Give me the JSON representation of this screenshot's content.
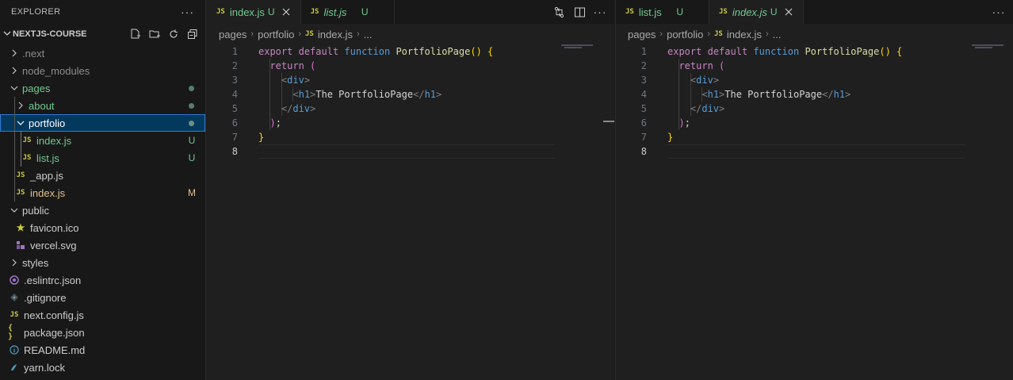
{
  "sidebar": {
    "header": "EXPLORER",
    "more": "···",
    "project": "NEXTJS-COURSE",
    "items": [
      {
        "label": ".next",
        "type": "folder",
        "open": false,
        "depth": 0
      },
      {
        "label": "node_modules",
        "type": "folder",
        "open": false,
        "depth": 0
      },
      {
        "label": "pages",
        "type": "folder",
        "open": true,
        "depth": 0
      },
      {
        "label": "about",
        "type": "folder",
        "open": false,
        "depth": 1
      },
      {
        "label": "portfolio",
        "type": "folder",
        "open": true,
        "depth": 1
      },
      {
        "label": "index.js",
        "type": "js",
        "depth": 2,
        "badge": "U"
      },
      {
        "label": "list.js",
        "type": "js",
        "depth": 2,
        "badge": "U"
      },
      {
        "label": "_app.js",
        "type": "js",
        "depth": 1
      },
      {
        "label": "index.js",
        "type": "js",
        "depth": 1,
        "badge": "M"
      },
      {
        "label": "public",
        "type": "folder",
        "open": true,
        "depth": 0
      },
      {
        "label": "favicon.ico",
        "type": "star",
        "depth": 1
      },
      {
        "label": "vercel.svg",
        "type": "svg",
        "depth": 1
      },
      {
        "label": "styles",
        "type": "folder",
        "open": false,
        "depth": 0
      },
      {
        "label": ".eslintrc.json",
        "type": "eslint",
        "depth": 0
      },
      {
        "label": ".gitignore",
        "type": "git",
        "depth": 0
      },
      {
        "label": "next.config.js",
        "type": "js",
        "depth": 0
      },
      {
        "label": "package.json",
        "type": "json",
        "depth": 0
      },
      {
        "label": "README.md",
        "type": "info",
        "depth": 0
      },
      {
        "label": "yarn.lock",
        "type": "yarn",
        "depth": 0
      }
    ]
  },
  "icons": {
    "js": "JS",
    "json": "{ }",
    "star": "★"
  },
  "editor1": {
    "tabs": [
      {
        "label": "index.js",
        "status": "U",
        "active": true
      },
      {
        "label": "list.js",
        "status": "U",
        "active": false
      }
    ],
    "breadcrumb": [
      "pages",
      "portfolio",
      "index.js",
      "..."
    ],
    "actions_more": "···"
  },
  "editor2": {
    "tabs": [
      {
        "label": "list.js",
        "status": "U",
        "active": false
      },
      {
        "label": "index.js",
        "status": "U",
        "active": true
      }
    ],
    "breadcrumb": [
      "pages",
      "portfolio",
      "index.js",
      "..."
    ],
    "actions_more": "···"
  },
  "code": {
    "line_numbers": [
      "1",
      "2",
      "3",
      "4",
      "5",
      "6",
      "7",
      "8"
    ],
    "l1": {
      "export": "export",
      "default": "default",
      "function": "function",
      "name": "PortfolioPage",
      "parens": "()",
      "brace": "{"
    },
    "l2": {
      "return": "return",
      "paren": "("
    },
    "l3": {
      "open": "<",
      "tag": "div",
      "close": ">"
    },
    "l4": {
      "open": "<",
      "tag": "h1",
      "close": ">",
      "text": "The PortfolioPage",
      "eopen": "</",
      "etag": "h1",
      "eclose": ">"
    },
    "l5": {
      "open": "</",
      "tag": "div",
      "close": ">"
    },
    "l6": {
      "paren": ")",
      "semi": ";"
    },
    "l7": {
      "brace": "}"
    }
  }
}
